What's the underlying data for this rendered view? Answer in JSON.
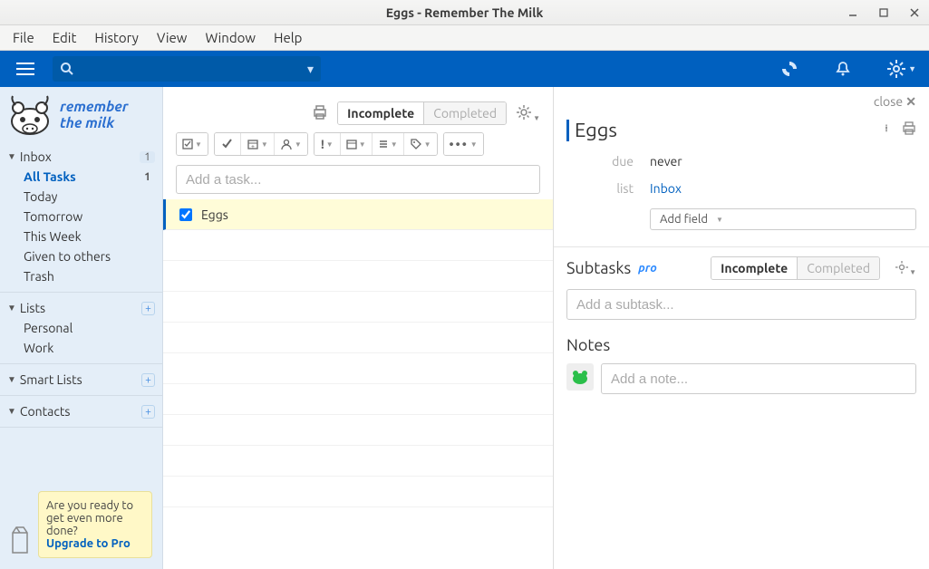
{
  "window": {
    "title": "Eggs - Remember The Milk"
  },
  "menubar": {
    "items": [
      "File",
      "Edit",
      "History",
      "View",
      "Window",
      "Help"
    ]
  },
  "logo": {
    "line1": "remember",
    "line2": "the milk"
  },
  "sidebar": {
    "inbox": {
      "label": "Inbox",
      "count": "1",
      "items": [
        {
          "label": "All Tasks",
          "count": "1",
          "selected": true
        },
        {
          "label": "Today"
        },
        {
          "label": "Tomorrow"
        },
        {
          "label": "This Week"
        },
        {
          "label": "Given to others"
        },
        {
          "label": "Trash"
        }
      ]
    },
    "lists": {
      "label": "Lists",
      "items": [
        {
          "label": "Personal"
        },
        {
          "label": "Work"
        }
      ]
    },
    "smartlists": {
      "label": "Smart Lists"
    },
    "contacts": {
      "label": "Contacts"
    },
    "upgrade": {
      "text": "Are you ready to get even more done?",
      "link": "Upgrade to Pro"
    }
  },
  "list": {
    "tabs": {
      "incomplete": "Incomplete",
      "completed": "Completed"
    },
    "add_placeholder": "Add a task...",
    "tasks": [
      {
        "name": "Eggs",
        "checked": true
      }
    ]
  },
  "detail": {
    "close": "close",
    "title": "Eggs",
    "fields": {
      "due": {
        "label": "due",
        "value": "never"
      },
      "list": {
        "label": "list",
        "value": "Inbox"
      }
    },
    "add_field": "Add field",
    "subtasks": {
      "title": "Subtasks",
      "badge": "pro",
      "tabs": {
        "incomplete": "Incomplete",
        "completed": "Completed"
      },
      "add_placeholder": "Add a subtask..."
    },
    "notes": {
      "title": "Notes",
      "add_placeholder": "Add a note..."
    }
  }
}
